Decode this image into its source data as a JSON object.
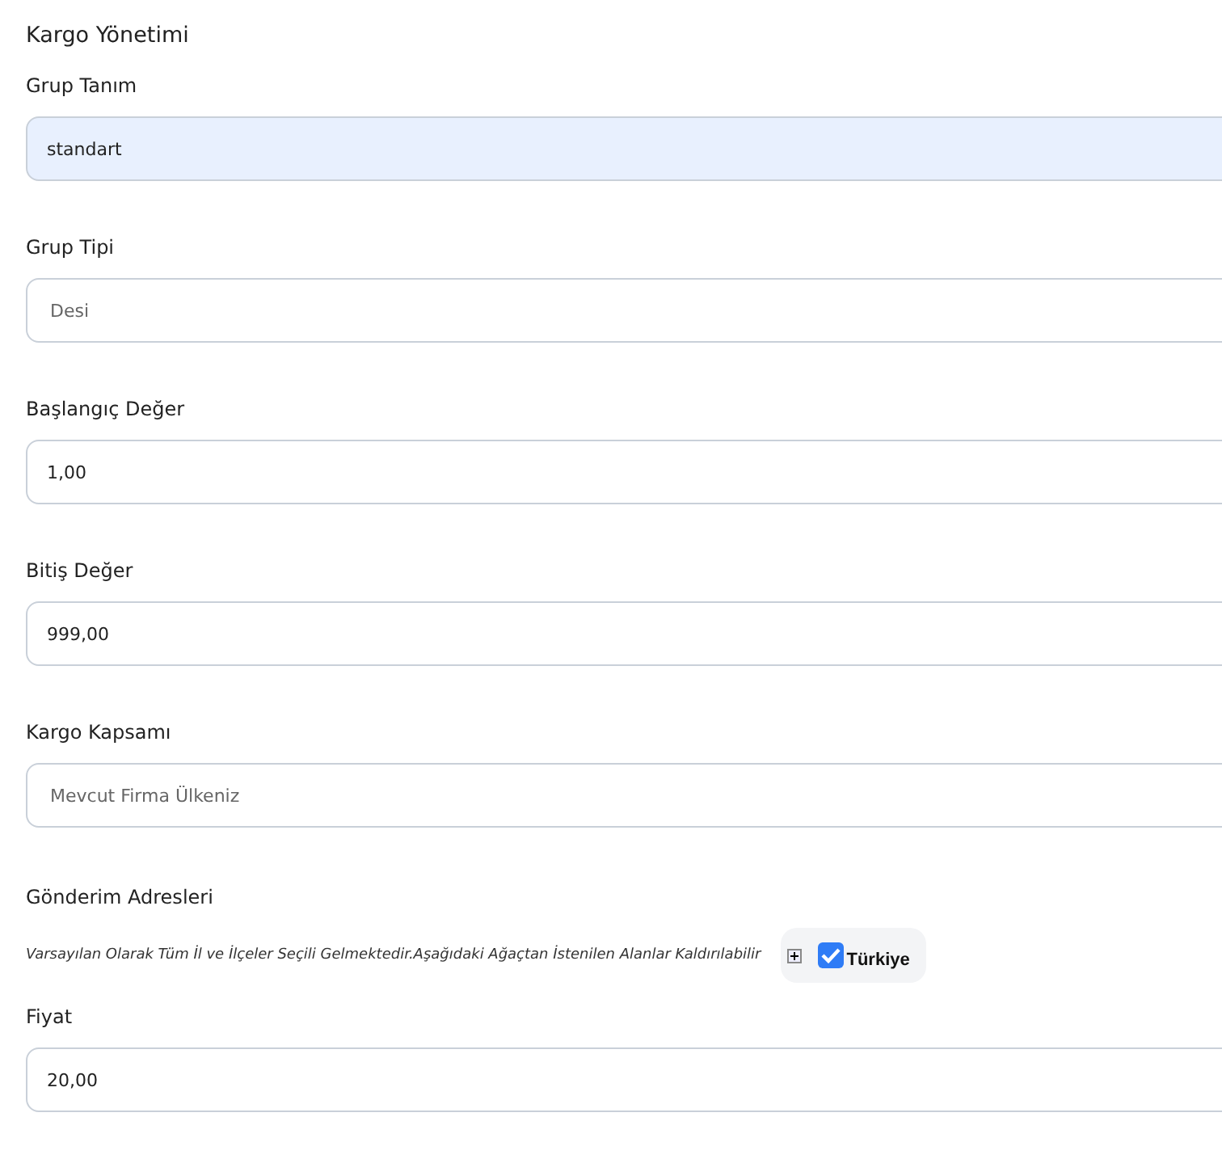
{
  "title": "Kargo Yönetimi",
  "fields_top": [
    {
      "label": "Grup Tanım",
      "kind": "input",
      "value": "standart",
      "highlighted": true
    },
    {
      "label": "Grup Tipi",
      "kind": "select",
      "value": "Desi",
      "highlighted": false
    },
    {
      "label": "Başlangıç Değer",
      "kind": "input",
      "value": "1,00",
      "highlighted": false
    },
    {
      "label": "Bitiş Değer",
      "kind": "input",
      "value": "999,00",
      "highlighted": false
    },
    {
      "label": "Kargo Kapsamı",
      "kind": "select",
      "value": "Mevcut Firma Ülkeniz",
      "highlighted": false
    }
  ],
  "addresses": {
    "label": "Gönderim Adresleri",
    "note": "Varsayılan Olarak Tüm İl ve İlçeler Seçili Gelmektedir.Aşağıdaki Ağaçtan İstenilen Alanlar Kaldırılabilir",
    "tree": [
      {
        "label": "Türkiye",
        "checked": true,
        "expanded": false
      }
    ]
  },
  "fields_bottom": [
    {
      "label": "Fiyat",
      "kind": "input",
      "value": "20,00",
      "highlighted": false
    }
  ]
}
